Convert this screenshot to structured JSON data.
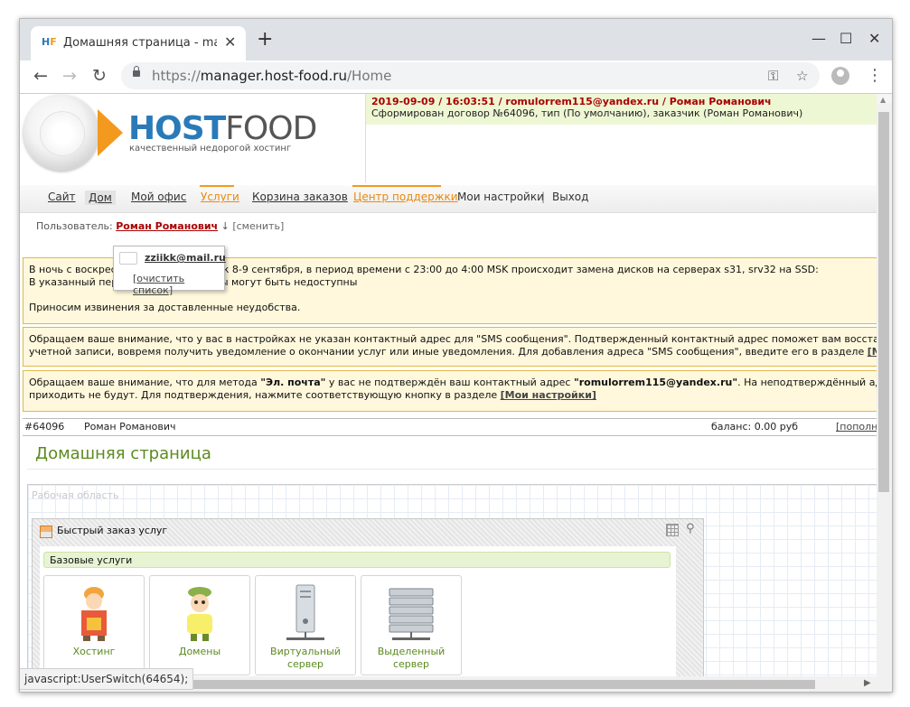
{
  "browser": {
    "tab_title": "Домашняя страница - manager.host-food.ru",
    "url_prefix": "https://",
    "url_host": "manager.host-food.ru",
    "url_path": "/Home",
    "favicon_text": "H",
    "new_tab_symbol": "+",
    "minimize_symbol": "—",
    "maximize_symbol": "☐",
    "close_symbol": "✕",
    "tab_close_symbol": "✕",
    "back_symbol": "←",
    "forward_symbol": "→",
    "reload_symbol": "↻",
    "key_symbol": "⚿",
    "star_symbol": "☆",
    "menu_symbol": "⋮"
  },
  "logo": {
    "host": "HOST",
    "food": "FOOD",
    "tagline": "качественный недорогой хостинг"
  },
  "log": {
    "title": "2019-09-09 / 16:03:51 / romulorrem115@yandex.ru / Роман Романович",
    "text": "Сформирован договор №64096, тип (По умолчанию), заказчик (Роман Романович)"
  },
  "nav": {
    "site": "Сайт",
    "home": "Дом",
    "office": "Мой офис",
    "services": "Услуги",
    "cart": "Корзина заказов",
    "support": "Центр поддержки",
    "settings": "Мои настройки",
    "separator": "|",
    "logout": "Выход"
  },
  "user_line": {
    "label": "Пользователь:",
    "name": "Роман Романович",
    "arrow": "↓",
    "change": "[сменить]"
  },
  "user_dropdown": {
    "email": "zziikk@mail.ru",
    "clear": "очистить список"
  },
  "notices": {
    "n1_line1": "В ночь с воскресенья на понедельник 8-9 сентября, в период времени с 23:00 до 4:00 MSK происходит замена дисков на серверах s31, srv32 на SSD:",
    "n1_line2": "В указанный период сервисы и сайты могут быть недоступны",
    "n1_line3": "Приносим извинения за доставленные неудобства.",
    "n2_line1": "Обращаем ваше внимание, что у вас в настройках не указан контактный адрес для \"SMS сообщения\". Подтвержденный контактный адрес поможет вам восстановить доступ к",
    "n2_line2": "учетной записи, вовремя получить уведомление о окончании услуг или иные уведомления. Для добавления адреса \"SMS сообщения\", введите его в разделе ",
    "n2_link": "[Мои настройки]",
    "n3_part1": "Обращаем ваше внимание, что для метода ",
    "n3_method": "\"Эл. почта\"",
    "n3_part2": " у вас не подтверждён ваш контактный адрес ",
    "n3_email": "\"romulorrem115@yandex.ru\"",
    "n3_part3": ". На неподтверждённый адрес, оповещения",
    "n3_line2": "приходить не будут. Для подтверждения, нажмите соответствующую кнопку в разделе ",
    "n3_link": "[Мои настройки]"
  },
  "account": {
    "number": "#64096",
    "name": "Роман Романович",
    "balance": "баланс: 0.00 руб",
    "topup": "[пополнить]"
  },
  "page": {
    "title": "Домашняя страница",
    "workarea_label": "Рабочая область"
  },
  "widget": {
    "title": "Быстрый заказ услуг",
    "category": "Базовые услуги",
    "services": [
      {
        "line1": "Хостинг",
        "line2": ""
      },
      {
        "line1": "Домены",
        "line2": ""
      },
      {
        "line1": "Виртуальный",
        "line2": "сервер"
      },
      {
        "line1": "Выделенный",
        "line2": "сервер"
      }
    ]
  },
  "status_bar": "javascript:UserSwitch(64654);",
  "colors": {
    "accent_green": "#5b8a1e",
    "accent_orange": "#f39a1e",
    "brand_blue": "#2a7ab8",
    "error_red": "#aa0000",
    "notice_bg": "#fff8dc"
  }
}
